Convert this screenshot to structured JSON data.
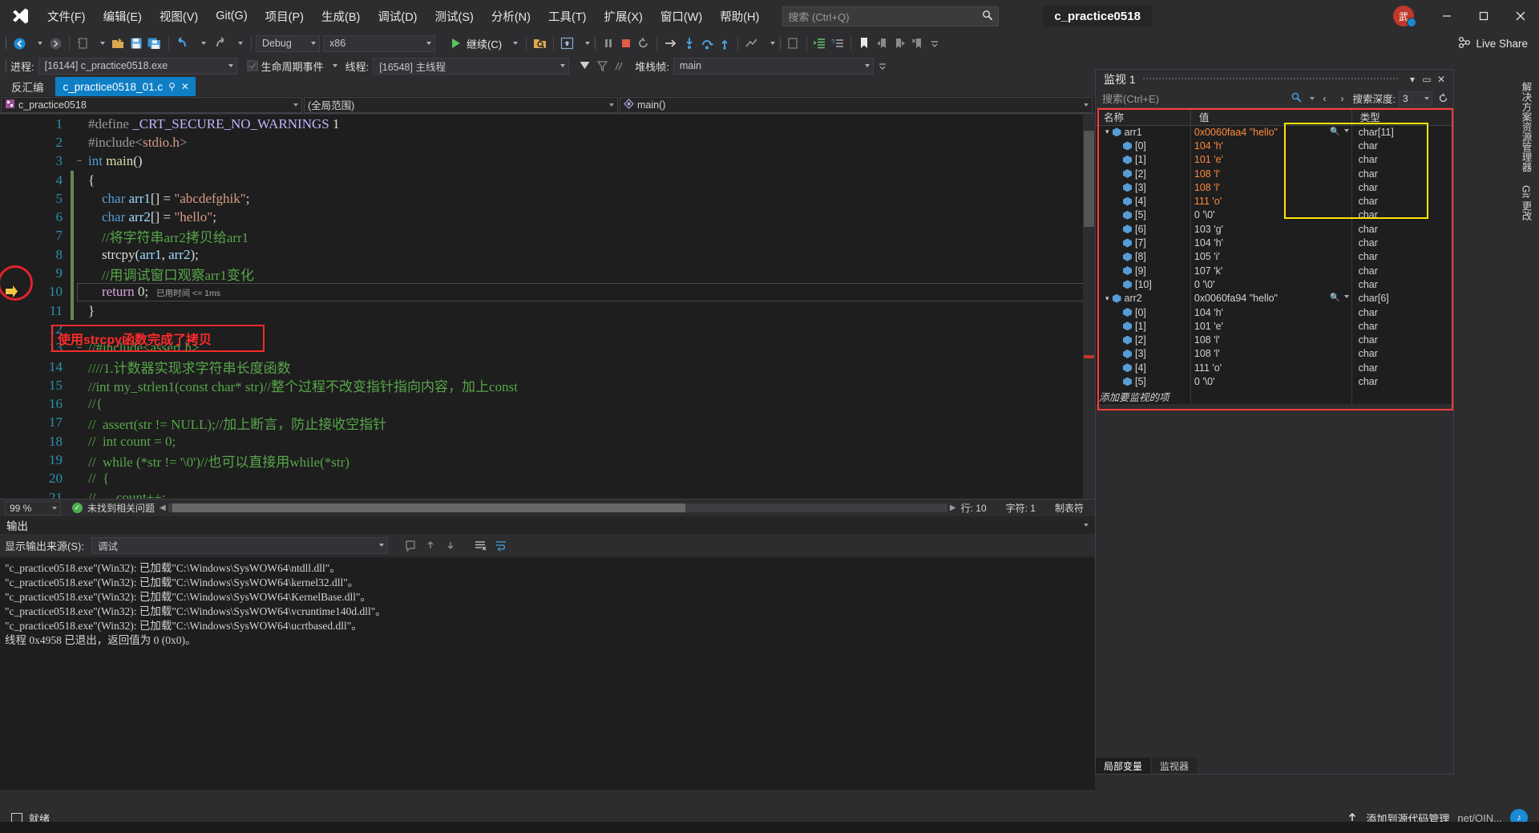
{
  "app": {
    "solution_name": "c_practice0518",
    "avatar_initial": "武",
    "live_share": "Live Share"
  },
  "menu": {
    "items": [
      {
        "label": "文件(F)",
        "name": "menu-file"
      },
      {
        "label": "编辑(E)",
        "name": "menu-edit"
      },
      {
        "label": "视图(V)",
        "name": "menu-view"
      },
      {
        "label": "Git(G)",
        "name": "menu-git"
      },
      {
        "label": "项目(P)",
        "name": "menu-project"
      },
      {
        "label": "生成(B)",
        "name": "menu-build"
      },
      {
        "label": "调试(D)",
        "name": "menu-debug"
      },
      {
        "label": "测试(S)",
        "name": "menu-test"
      },
      {
        "label": "分析(N)",
        "name": "menu-analyze"
      },
      {
        "label": "工具(T)",
        "name": "menu-tools"
      },
      {
        "label": "扩展(X)",
        "name": "menu-extensions"
      },
      {
        "label": "窗口(W)",
        "name": "menu-window"
      },
      {
        "label": "帮助(H)",
        "name": "menu-help"
      }
    ]
  },
  "search": {
    "placeholder": "搜索 (Ctrl+Q)"
  },
  "toolbar": {
    "config": "Debug",
    "platform": "x86",
    "continue_label": "继续(C)"
  },
  "context_bar": {
    "process_label": "进程:",
    "process_value": "[16144] c_practice0518.exe",
    "lifecycle_label": "生命周期事件",
    "thread_label": "线程:",
    "thread_value": "[16548] 主线程",
    "stackframe_label": "堆栈帧:",
    "stackframe_value": "main"
  },
  "editor": {
    "tab_disasm": "反汇编",
    "tab_file": "c_practice0518_01.c",
    "nav_project": "c_practice0518",
    "nav_scope": "(全局范围)",
    "nav_member": "main()",
    "elapsed": "已用时间 <= 1ms",
    "annotation": "使用strcpy函数完成了拷贝",
    "lines": [
      {
        "n": "1",
        "fold": "",
        "changed": false,
        "tokens": [
          {
            "t": "#define ",
            "c": "pp"
          },
          {
            "t": "_CRT_SECURE_NO_WARNINGS",
            "c": "mac"
          },
          {
            "t": " 1",
            "c": "pl"
          }
        ]
      },
      {
        "n": "2",
        "fold": "",
        "changed": false,
        "tokens": [
          {
            "t": "#include<",
            "c": "pp"
          },
          {
            "t": "stdio.h",
            "c": "inc"
          },
          {
            "t": ">",
            "c": "pp"
          }
        ]
      },
      {
        "n": "3",
        "fold": "−",
        "changed": false,
        "tokens": [
          {
            "t": "int",
            "c": "k"
          },
          {
            "t": " ",
            "c": "pl"
          },
          {
            "t": "main",
            "c": "fn"
          },
          {
            "t": "()",
            "c": "pl"
          }
        ]
      },
      {
        "n": "4",
        "fold": "",
        "changed": true,
        "tokens": [
          {
            "t": "{",
            "c": "pl"
          }
        ]
      },
      {
        "n": "5",
        "fold": "",
        "changed": true,
        "tokens": [
          {
            "t": "    ",
            "c": "pl"
          },
          {
            "t": "char",
            "c": "k"
          },
          {
            "t": " ",
            "c": "pl"
          },
          {
            "t": "arr1",
            "c": "id"
          },
          {
            "t": "[] = ",
            "c": "pl"
          },
          {
            "t": "\"abcdefghik\"",
            "c": "str"
          },
          {
            "t": ";",
            "c": "pl"
          }
        ]
      },
      {
        "n": "6",
        "fold": "",
        "changed": true,
        "tokens": [
          {
            "t": "    ",
            "c": "pl"
          },
          {
            "t": "char",
            "c": "k"
          },
          {
            "t": " ",
            "c": "pl"
          },
          {
            "t": "arr2",
            "c": "id"
          },
          {
            "t": "[] = ",
            "c": "pl"
          },
          {
            "t": "\"hello\"",
            "c": "str"
          },
          {
            "t": ";",
            "c": "pl"
          }
        ]
      },
      {
        "n": "7",
        "fold": "",
        "changed": true,
        "tokens": [
          {
            "t": "    //将字符串arr2拷贝给arr1",
            "c": "cmt"
          }
        ]
      },
      {
        "n": "8",
        "fold": "",
        "changed": true,
        "tokens": [
          {
            "t": "    ",
            "c": "pl"
          },
          {
            "t": "strcpy",
            "c": "pl"
          },
          {
            "t": "(",
            "c": "pl"
          },
          {
            "t": "arr1",
            "c": "id"
          },
          {
            "t": ", ",
            "c": "pl"
          },
          {
            "t": "arr2",
            "c": "id"
          },
          {
            "t": ");",
            "c": "pl"
          }
        ]
      },
      {
        "n": "9",
        "fold": "",
        "changed": true,
        "tokens": [
          {
            "t": "    //用调试窗口观察arr1变化",
            "c": "cmt"
          }
        ]
      },
      {
        "n": "10",
        "fold": "",
        "changed": true,
        "tokens": [
          {
            "t": "    ",
            "c": "pl"
          },
          {
            "t": "return",
            "c": "k2"
          },
          {
            "t": " ",
            "c": "pl"
          },
          {
            "t": "0",
            "c": "pl"
          },
          {
            "t": ";",
            "c": "pl"
          }
        ],
        "elapsed": true
      },
      {
        "n": "11",
        "fold": "",
        "changed": true,
        "tokens": [
          {
            "t": "}",
            "c": "pl"
          }
        ]
      },
      {
        "n": "12",
        "fold": "",
        "changed": false,
        "tokens": [
          {
            "t": "",
            "c": "pl"
          }
        ]
      },
      {
        "n": "13",
        "fold": "−",
        "changed": false,
        "tokens": [
          {
            "t": "//#include<assert.h>",
            "c": "cmt"
          }
        ]
      },
      {
        "n": "14",
        "fold": "",
        "changed": false,
        "tokens": [
          {
            "t": "////1.计数器实现求字符串长度函数",
            "c": "cmt"
          }
        ]
      },
      {
        "n": "15",
        "fold": "",
        "changed": false,
        "tokens": [
          {
            "t": "//int my_strlen1(const char* str)//整个过程不改变指针指向内容，加上const",
            "c": "cmt"
          }
        ]
      },
      {
        "n": "16",
        "fold": "",
        "changed": false,
        "tokens": [
          {
            "t": "//{",
            "c": "cmt"
          }
        ]
      },
      {
        "n": "17",
        "fold": "",
        "changed": false,
        "tokens": [
          {
            "t": "//  assert(str != NULL);//加上断言，防止接收空指针",
            "c": "cmt"
          }
        ]
      },
      {
        "n": "18",
        "fold": "",
        "changed": false,
        "tokens": [
          {
            "t": "//  int count = 0;",
            "c": "cmt"
          }
        ]
      },
      {
        "n": "19",
        "fold": "",
        "changed": false,
        "tokens": [
          {
            "t": "//  while (*str != '\\0')//也可以直接用while(*str)",
            "c": "cmt"
          }
        ]
      },
      {
        "n": "20",
        "fold": "",
        "changed": false,
        "tokens": [
          {
            "t": "//  {",
            "c": "cmt"
          }
        ]
      },
      {
        "n": "21",
        "fold": "",
        "changed": false,
        "tokens": [
          {
            "t": "//      count++;",
            "c": "cmt"
          }
        ]
      }
    ]
  },
  "editor_status": {
    "zoom": "99 %",
    "problems": "未找到相关问题",
    "line": "行: 10",
    "col": "字符: 1",
    "mode": "制表符"
  },
  "output": {
    "title": "输出",
    "source_label": "显示输出来源(S):",
    "source_value": "调试",
    "lines": [
      "\"c_practice0518.exe\"(Win32): 已加载\"C:\\Windows\\SysWOW64\\ntdll.dll\"。",
      "\"c_practice0518.exe\"(Win32): 已加载\"C:\\Windows\\SysWOW64\\kernel32.dll\"。",
      "\"c_practice0518.exe\"(Win32): 已加载\"C:\\Windows\\SysWOW64\\KernelBase.dll\"。",
      "\"c_practice0518.exe\"(Win32): 已加载\"C:\\Windows\\SysWOW64\\vcruntime140d.dll\"。",
      "\"c_practice0518.exe\"(Win32): 已加载\"C:\\Windows\\SysWOW64\\ucrtbased.dll\"。",
      "线程 0x4958 已退出，返回值为 0 (0x0)。"
    ]
  },
  "watch": {
    "title": "监视 1",
    "search_placeholder": "搜索(Ctrl+E)",
    "depth_label": "搜索深度:",
    "depth_value": "3",
    "columns": [
      "名称",
      "值",
      "类型"
    ],
    "add_row": "添加要监视的项",
    "tabs": [
      "局部变量",
      "监视器"
    ],
    "rows": [
      {
        "indent": 0,
        "expander": "▾",
        "name": "arr1",
        "value": "0x0060faa4 \"hello\"",
        "type": "char[11]",
        "magnifier": true,
        "highlight": true
      },
      {
        "indent": 1,
        "expander": "",
        "name": "[0]",
        "value": "104 'h'",
        "type": "char",
        "highlight": true
      },
      {
        "indent": 1,
        "expander": "",
        "name": "[1]",
        "value": "101 'e'",
        "type": "char",
        "highlight": true
      },
      {
        "indent": 1,
        "expander": "",
        "name": "[2]",
        "value": "108 'l'",
        "type": "char",
        "highlight": true
      },
      {
        "indent": 1,
        "expander": "",
        "name": "[3]",
        "value": "108 'l'",
        "type": "char",
        "highlight": true
      },
      {
        "indent": 1,
        "expander": "",
        "name": "[4]",
        "value": "111 'o'",
        "type": "char",
        "highlight": true
      },
      {
        "indent": 1,
        "expander": "",
        "name": "[5]",
        "value": "0 '\\0'",
        "type": "char",
        "highlight": false
      },
      {
        "indent": 1,
        "expander": "",
        "name": "[6]",
        "value": "103 'g'",
        "type": "char",
        "highlight": false
      },
      {
        "indent": 1,
        "expander": "",
        "name": "[7]",
        "value": "104 'h'",
        "type": "char",
        "highlight": false
      },
      {
        "indent": 1,
        "expander": "",
        "name": "[8]",
        "value": "105 'i'",
        "type": "char",
        "highlight": false
      },
      {
        "indent": 1,
        "expander": "",
        "name": "[9]",
        "value": "107 'k'",
        "type": "char",
        "highlight": false
      },
      {
        "indent": 1,
        "expander": "",
        "name": "[10]",
        "value": "0 '\\0'",
        "type": "char",
        "highlight": false
      },
      {
        "indent": 0,
        "expander": "▾",
        "name": "arr2",
        "value": "0x0060fa94 \"hello\"",
        "type": "char[6]",
        "magnifier": true,
        "highlight": false
      },
      {
        "indent": 1,
        "expander": "",
        "name": "[0]",
        "value": "104 'h'",
        "type": "char",
        "highlight": false
      },
      {
        "indent": 1,
        "expander": "",
        "name": "[1]",
        "value": "101 'e'",
        "type": "char",
        "highlight": false
      },
      {
        "indent": 1,
        "expander": "",
        "name": "[2]",
        "value": "108 'l'",
        "type": "char",
        "highlight": false
      },
      {
        "indent": 1,
        "expander": "",
        "name": "[3]",
        "value": "108 'l'",
        "type": "char",
        "highlight": false
      },
      {
        "indent": 1,
        "expander": "",
        "name": "[4]",
        "value": "111 'o'",
        "type": "char",
        "highlight": false
      },
      {
        "indent": 1,
        "expander": "",
        "name": "[5]",
        "value": "0 '\\0'",
        "type": "char",
        "highlight": false
      }
    ]
  },
  "right_strip": {
    "label1": "解决方案资源管理器",
    "label2": "Git 更改"
  },
  "statusbar": {
    "ready": "就绪",
    "add_source": "添加到源代码管理",
    "watermark": "net/QIN..."
  }
}
